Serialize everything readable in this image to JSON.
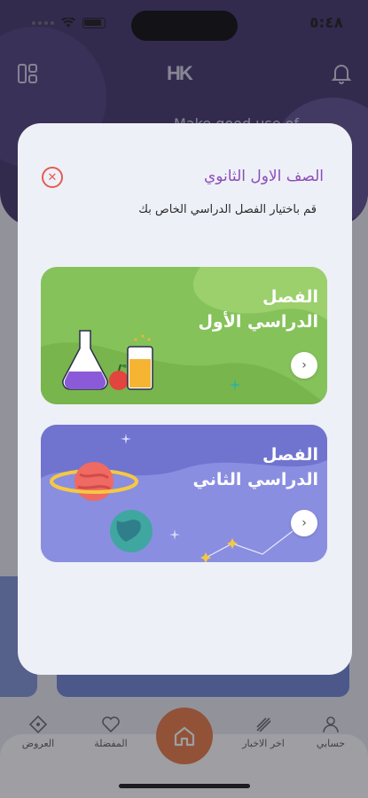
{
  "status_bar": {
    "time": "٥:٤٨"
  },
  "header": {
    "logo": "HK",
    "title": "Make good use of"
  },
  "modal": {
    "title": "الصف الاول الثانوي",
    "subtitle": "قم باختيار الفصل الدراسي الخاص بك",
    "terms": [
      {
        "label": "الفصل\nالدراسي الأول",
        "color": "#85c25a"
      },
      {
        "label": "الفصل\nالدراسي الثاني",
        "color": "#7b7fd6"
      }
    ]
  },
  "bottom_nav": {
    "items": [
      {
        "label": "العروض",
        "icon": "offers-icon"
      },
      {
        "label": "المفضلة",
        "icon": "heart-icon"
      },
      {
        "label": "اخر الاخبار",
        "icon": "news-icon"
      },
      {
        "label": "حسابي",
        "icon": "user-icon"
      }
    ],
    "home_icon": "home-icon"
  },
  "colors": {
    "accent": "#8b4fb8",
    "close": "#e45b55",
    "home": "#e8763d"
  }
}
